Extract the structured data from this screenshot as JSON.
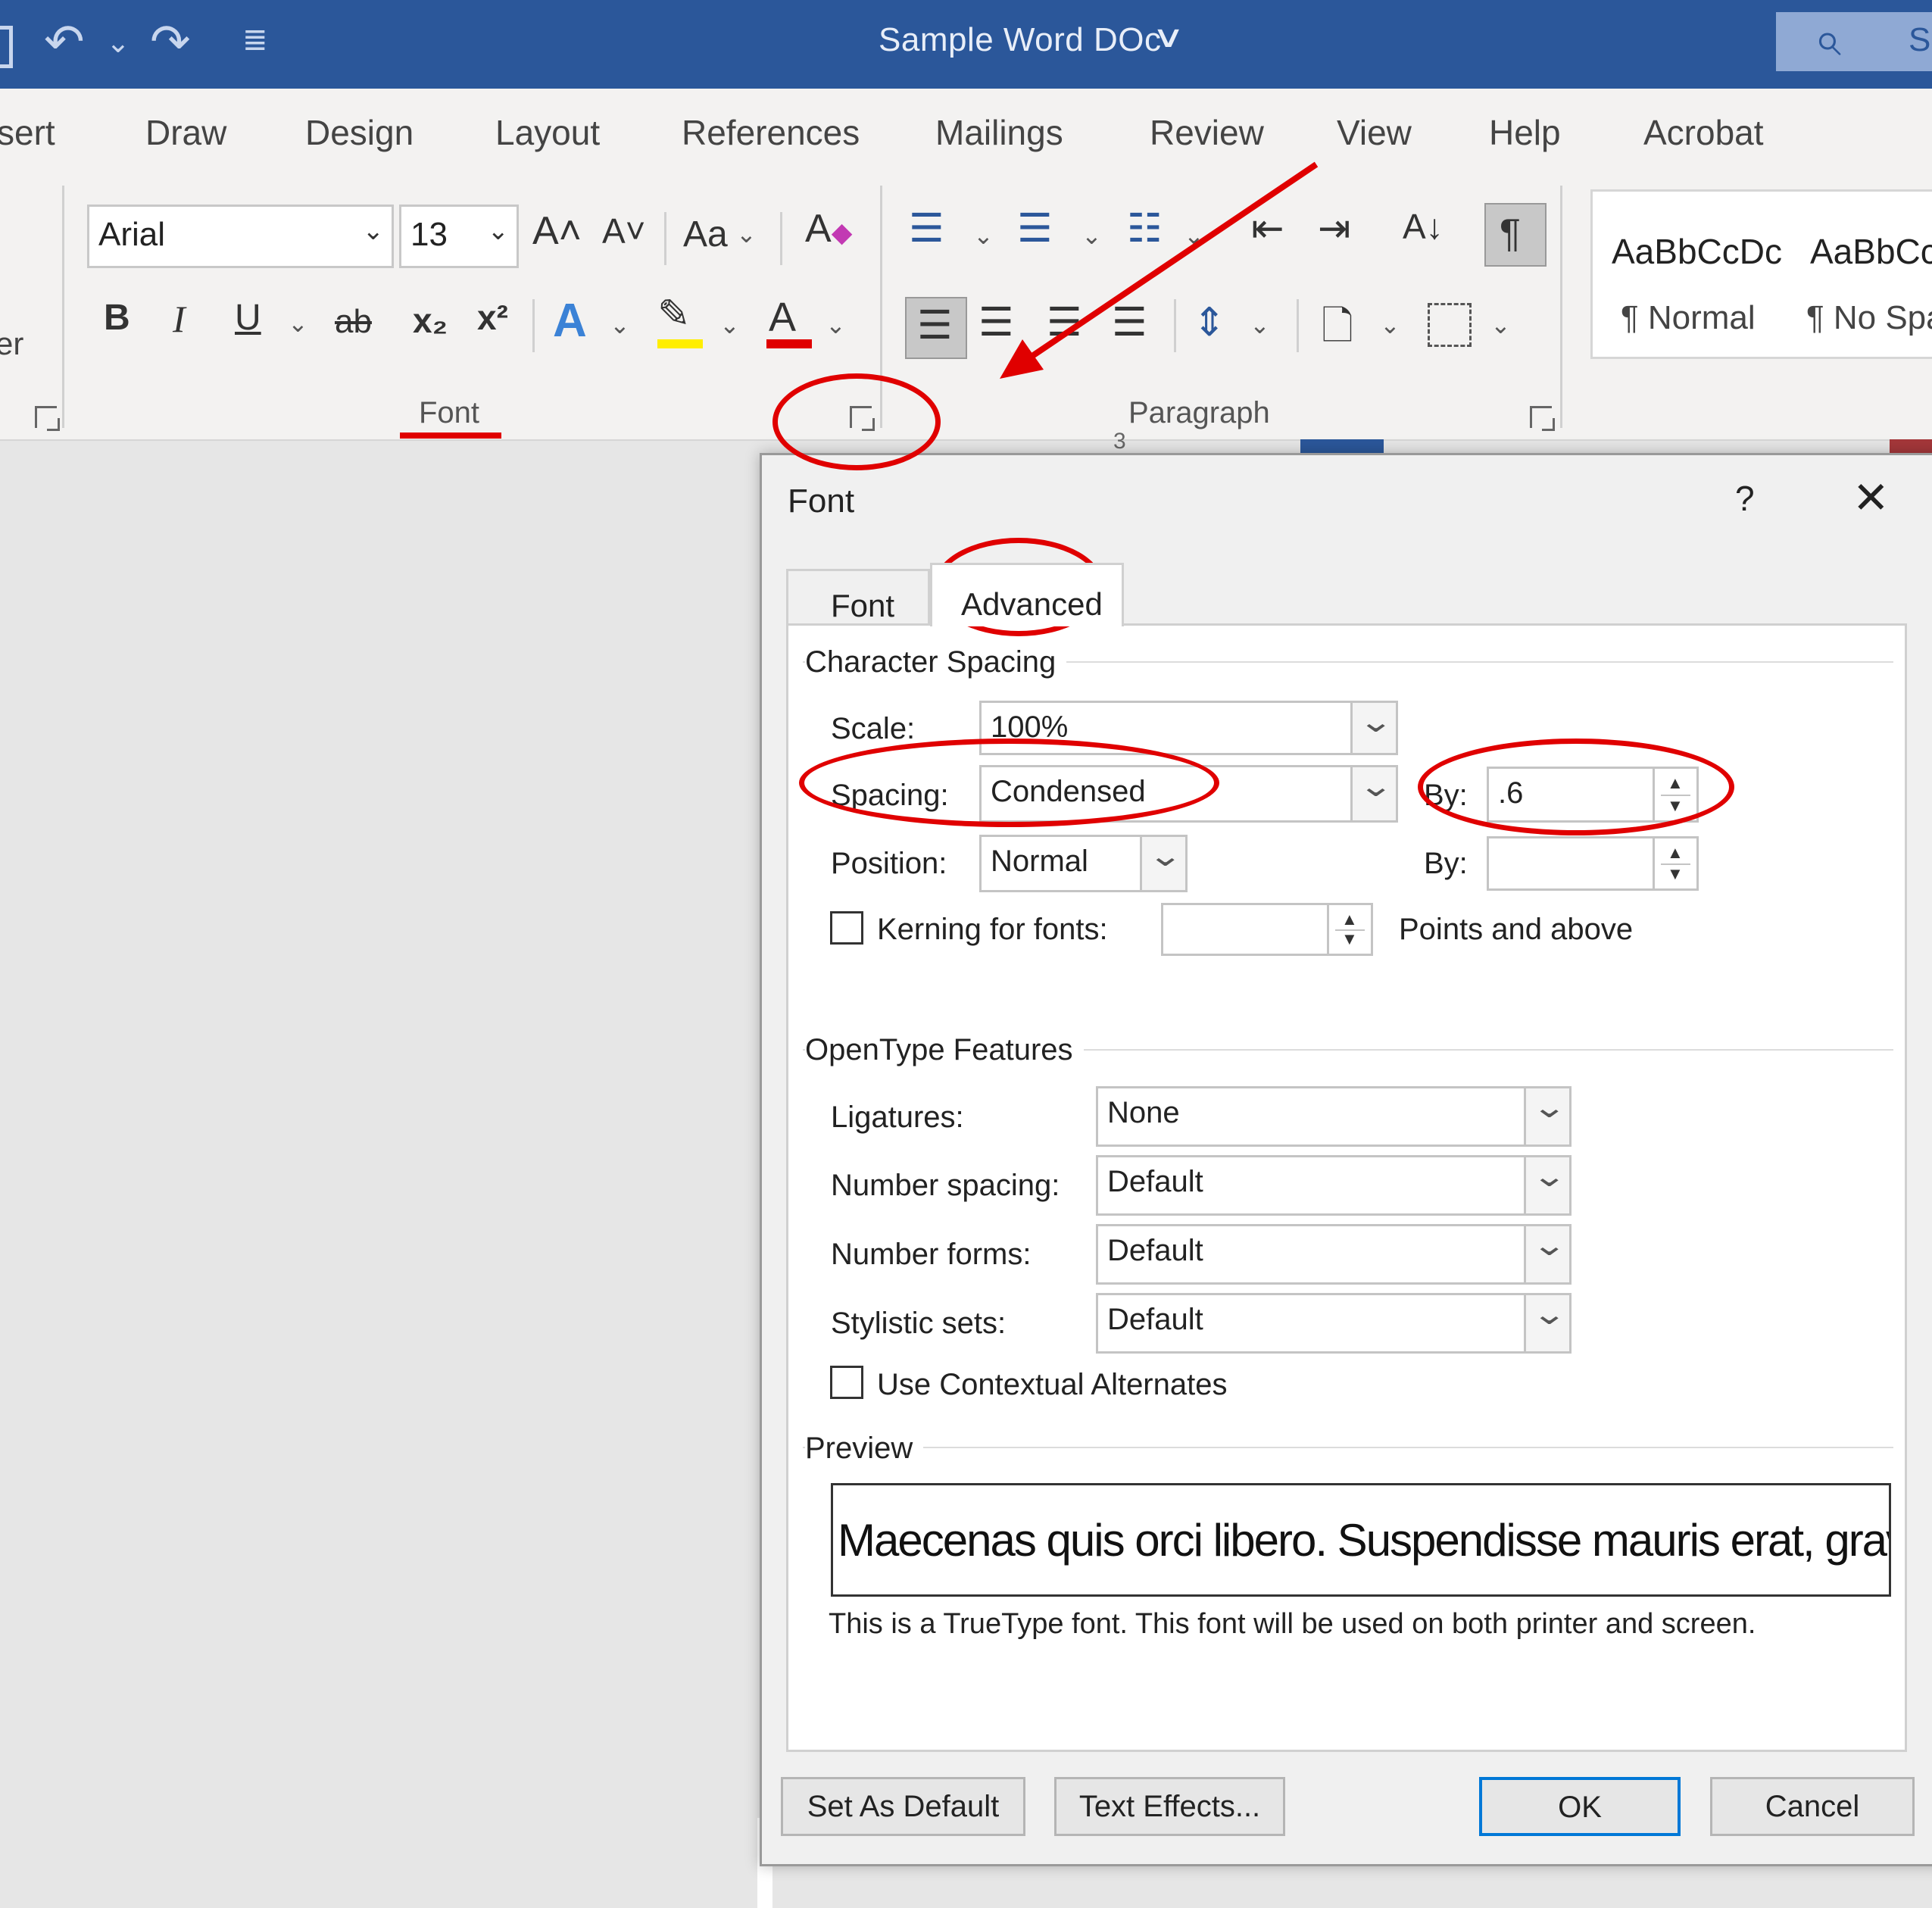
{
  "titlebar": {
    "doc_title": "Sample Word DOc",
    "title_chevron": "∨",
    "search_icon": "search-icon",
    "search_text": "S"
  },
  "tabs": [
    "sert",
    "Draw",
    "Design",
    "Layout",
    "References",
    "Mailings",
    "Review",
    "View",
    "Help",
    "Acrobat"
  ],
  "ribbon": {
    "font_name": "Arial",
    "font_size": "13",
    "grow": "A˄",
    "shrink": "A˅",
    "change_case": "Aa",
    "bold": "B",
    "italic": "I",
    "underline": "U",
    "strike": "ab",
    "subscript": "x₂",
    "superscript": "x²",
    "text_effects": "A",
    "font_color": "A",
    "left_edge_text": "er",
    "font_group": "Font",
    "paragraph_group": "Paragraph",
    "pilcrow": "¶",
    "sort": "A↓",
    "paragraph_ruler_number": "3",
    "styles": [
      {
        "sample": "AaBbCcDc",
        "name": "¶ Normal"
      },
      {
        "sample": "AaBbCc",
        "name": "¶ No Spa"
      }
    ]
  },
  "dialog": {
    "title": "Font",
    "help": "?",
    "close": "✕",
    "tabs": {
      "font": "Font",
      "advanced": "Advanced"
    },
    "character_spacing": {
      "header": "Character Spacing",
      "scale_label": "Scale:",
      "scale_value": "100%",
      "spacing_label": "Spacing:",
      "spacing_value": "Condensed",
      "spacing_by_label": "By:",
      "spacing_by_value": ".6",
      "position_label": "Position:",
      "position_value": "Normal",
      "position_by_label": "By:",
      "position_by_value": "",
      "kerning_label": "Kerning for fonts:",
      "kerning_value": "",
      "points_label": "Points and above"
    },
    "opentype": {
      "header": "OpenType Features",
      "ligatures_label": "Ligatures:",
      "ligatures_value": "None",
      "number_spacing_label": "Number spacing:",
      "number_spacing_value": "Default",
      "number_forms_label": "Number forms:",
      "number_forms_value": "Default",
      "stylistic_sets_label": "Stylistic sets:",
      "stylistic_sets_value": "Default",
      "contextual_label": "Use Contextual Alternates"
    },
    "preview": {
      "header": "Preview",
      "text": "Maecenas quis orci libero. Suspendisse mauris erat, gravida",
      "note": "This is a TrueType font. This font will be used on both printer and screen."
    },
    "buttons": {
      "set_default": "Set As Default",
      "text_effects": "Text Effects...",
      "ok": "OK",
      "cancel": "Cancel"
    }
  },
  "annotation_color": "#e00000"
}
